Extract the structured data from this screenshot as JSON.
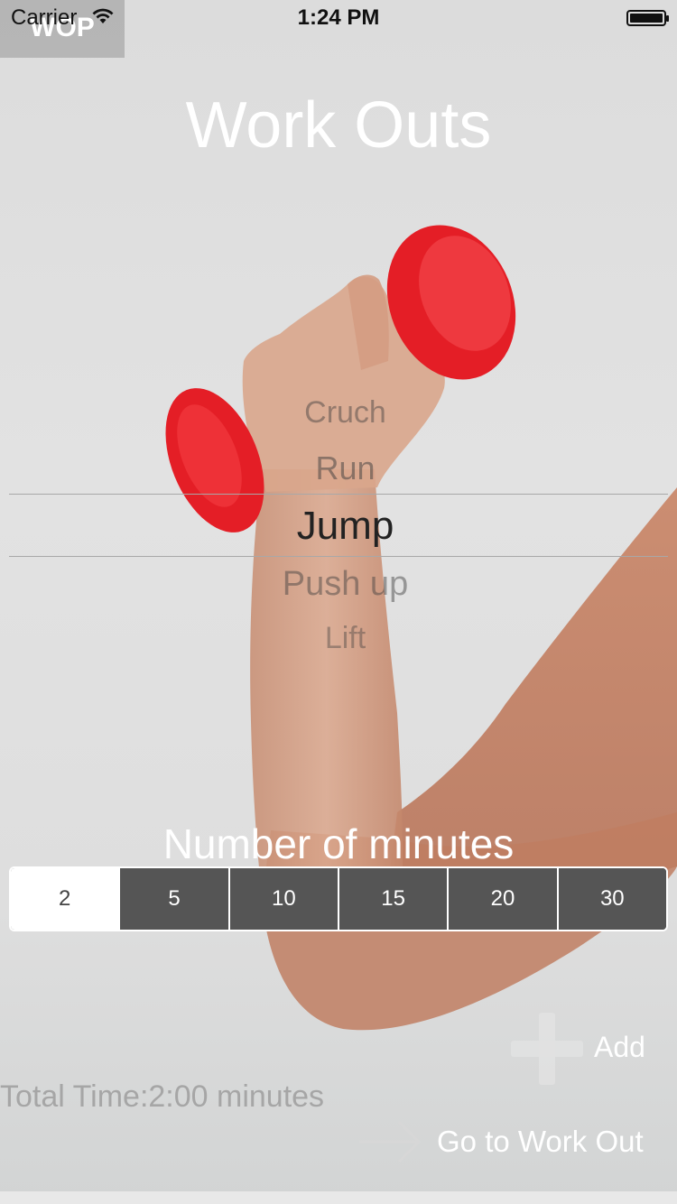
{
  "status_bar": {
    "carrier": "Carrier",
    "time": "1:24 PM"
  },
  "logo": {
    "text": "WOP"
  },
  "header": {
    "title": "Work Outs"
  },
  "picker": {
    "items": [
      "Cruch",
      "Run",
      "Jump",
      "Push up",
      "Lift"
    ],
    "selected": "Jump"
  },
  "minutes": {
    "label": "Number of minutes",
    "options": [
      "2",
      "5",
      "10",
      "15",
      "20",
      "30"
    ],
    "selected": "2"
  },
  "actions": {
    "add_label": "Add",
    "go_label": "Go to Work Out"
  },
  "summary": {
    "total_time": "Total Time:2:00 minutes"
  },
  "colors": {
    "dumbbell": "#e41e26",
    "segment_dark": "#555555",
    "text_light": "#ffffff"
  },
  "icons": {
    "add": "plus-icon",
    "go": "arrow-right-icon",
    "wifi": "wifi-icon",
    "battery": "battery-icon"
  }
}
